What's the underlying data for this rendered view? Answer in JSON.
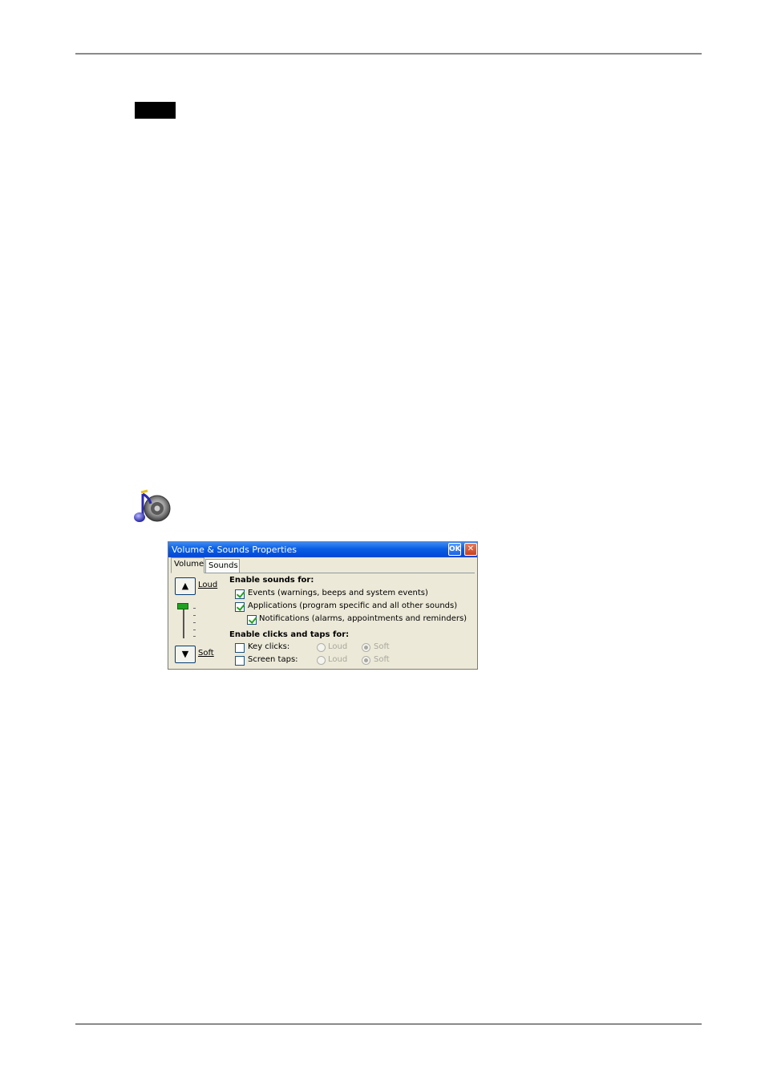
{
  "dialog": {
    "title": "Volume & Sounds Properties",
    "ok_label": "OK",
    "close_label": "✕",
    "tabs": [
      {
        "label": "Volume",
        "active": true
      },
      {
        "label": "Sounds",
        "active": false
      }
    ],
    "volume": {
      "up_glyph": "▲",
      "down_glyph": "▼",
      "loud_label": "Loud",
      "soft_label": "Soft",
      "level_fraction": 0.85
    },
    "sounds_section": {
      "heading": "Enable sounds for:",
      "items": [
        {
          "label": "Events (warnings, beeps and system events)",
          "checked": true
        },
        {
          "label": "Applications (program specific and all other sounds)",
          "checked": true
        },
        {
          "label": "Notifications (alarms, appointments and reminders)",
          "checked": true
        }
      ]
    },
    "clicks_section": {
      "heading": "Enable clicks and taps for:",
      "items": [
        {
          "label": "Key clicks:",
          "checked": false,
          "loud": "Loud",
          "soft": "Soft",
          "selected": "Soft"
        },
        {
          "label": "Screen taps:",
          "checked": false,
          "loud": "Loud",
          "soft": "Soft",
          "selected": "Soft"
        }
      ]
    }
  },
  "colors": {
    "title_bar": "#0a5ee3",
    "dialog_bg": "#ece9d8",
    "check": "#21a121"
  },
  "icons": [
    "volume-sounds-icon",
    "ok-icon",
    "close-icon",
    "arrow-up-icon",
    "arrow-down-icon"
  ]
}
